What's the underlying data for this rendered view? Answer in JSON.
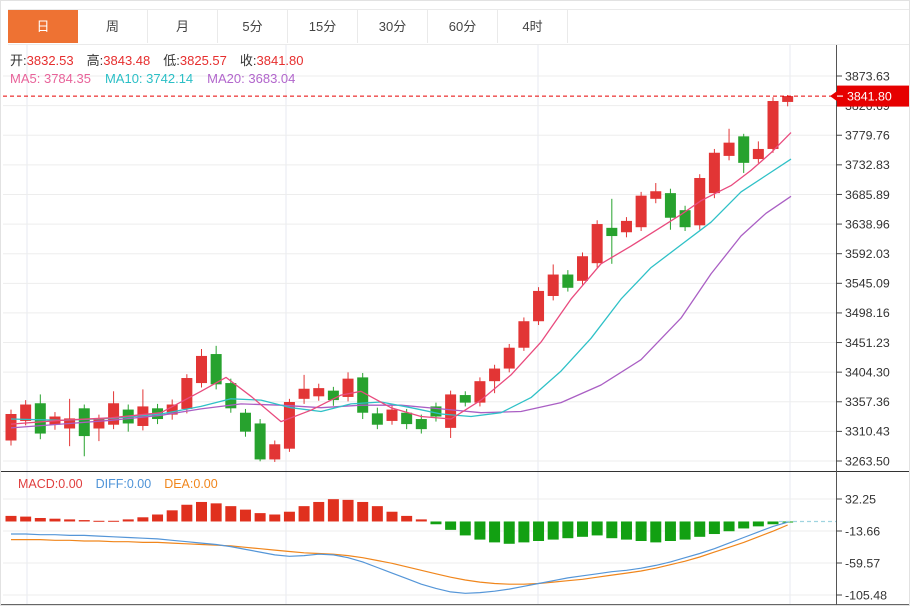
{
  "tabs": [
    {
      "label": "日",
      "active": true
    },
    {
      "label": "周",
      "active": false
    },
    {
      "label": "月",
      "active": false
    },
    {
      "label": "5分",
      "active": false
    },
    {
      "label": "15分",
      "active": false
    },
    {
      "label": "30分",
      "active": false
    },
    {
      "label": "60分",
      "active": false
    },
    {
      "label": "4时",
      "active": false
    }
  ],
  "info": {
    "open_label": "开:",
    "open": "3832.53",
    "high_label": "高:",
    "high": "3843.48",
    "low_label": "低:",
    "low": "3825.57",
    "close_label": "收:",
    "close": "3841.80",
    "ma5_label": "MA5:",
    "ma5": "3784.35",
    "ma10_label": "MA10:",
    "ma10": "3742.14",
    "ma20_label": "MA20:",
    "ma20": "3683.04"
  },
  "macd_labels": {
    "macd": "MACD:0.00",
    "diff": "DIFF:0.00",
    "dea": "DEA:0.00"
  },
  "price_tag": "3841.80",
  "colors": {
    "tab_active_bg": "#ee7233",
    "candle_up": "#e23535",
    "candle_down": "#27a22e",
    "ma5_line": "#e94b7e",
    "ma10_line": "#2fc1c7",
    "ma20_line": "#aa5fc4",
    "macd_bar_up": "#e0301e",
    "macd_bar_down": "#12a012",
    "diff_line": "#5596d8",
    "dea_line": "#f0861c",
    "price_tag_bg": "#e60000",
    "grid": "#ededed",
    "vgrid": "#e7eaf0",
    "axis_dark": "#444"
  },
  "chart_data": {
    "type": "candlestick+macd",
    "main": {
      "y_tick_labels": [
        "3873.63",
        "3826.69",
        "3779.76",
        "3732.83",
        "3685.89",
        "3638.96",
        "3592.03",
        "3545.09",
        "3498.16",
        "3451.23",
        "3404.30",
        "3357.36",
        "3310.43",
        "3263.50"
      ],
      "last_price": 3841.8,
      "candles": [
        [
          3296,
          3345,
          3288,
          3338
        ],
        [
          3327,
          3360,
          3320,
          3353
        ],
        [
          3355,
          3369,
          3298,
          3307
        ],
        [
          3321,
          3341,
          3313,
          3334
        ],
        [
          3315,
          3362,
          3287,
          3331
        ],
        [
          3347,
          3353,
          3271,
          3303
        ],
        [
          3315,
          3337,
          3295,
          3330
        ],
        [
          3321,
          3374,
          3314,
          3355
        ],
        [
          3345,
          3353,
          3310,
          3323
        ],
        [
          3319,
          3377,
          3312,
          3350
        ],
        [
          3347,
          3354,
          3322,
          3330
        ],
        [
          3337,
          3361,
          3329,
          3353
        ],
        [
          3346,
          3401,
          3339,
          3395
        ],
        [
          3387,
          3441,
          3380,
          3430
        ],
        [
          3433,
          3446,
          3377,
          3385
        ],
        [
          3387,
          3394,
          3340,
          3347
        ],
        [
          3340,
          3346,
          3302,
          3310
        ],
        [
          3323,
          3330,
          3263,
          3266
        ],
        [
          3266,
          3296,
          3262,
          3290
        ],
        [
          3283,
          3362,
          3278,
          3357
        ],
        [
          3362,
          3400,
          3354,
          3378
        ],
        [
          3366,
          3386,
          3359,
          3379
        ],
        [
          3375,
          3381,
          3351,
          3360
        ],
        [
          3365,
          3404,
          3358,
          3394
        ],
        [
          3396,
          3403,
          3330,
          3340
        ],
        [
          3339,
          3348,
          3314,
          3321
        ],
        [
          3327,
          3353,
          3321,
          3345
        ],
        [
          3340,
          3346,
          3314,
          3322
        ],
        [
          3330,
          3337,
          3307,
          3314
        ],
        [
          3350,
          3356,
          3326,
          3334
        ],
        [
          3316,
          3375,
          3300,
          3369
        ],
        [
          3368,
          3374,
          3350,
          3356
        ],
        [
          3356,
          3396,
          3350,
          3390
        ],
        [
          3390,
          3416,
          3371,
          3410
        ],
        [
          3410,
          3449,
          3404,
          3443
        ],
        [
          3443,
          3491,
          3438,
          3485
        ],
        [
          3485,
          3539,
          3479,
          3533
        ],
        [
          3525,
          3575,
          3518,
          3559
        ],
        [
          3559,
          3566,
          3532,
          3538
        ],
        [
          3549,
          3594,
          3543,
          3588
        ],
        [
          3577,
          3645,
          3570,
          3639
        ],
        [
          3633,
          3679,
          3576,
          3620
        ],
        [
          3626,
          3650,
          3618,
          3644
        ],
        [
          3634,
          3690,
          3628,
          3684
        ],
        [
          3679,
          3704,
          3672,
          3691
        ],
        [
          3688,
          3695,
          3630,
          3649
        ],
        [
          3661,
          3668,
          3628,
          3634
        ],
        [
          3637,
          3718,
          3630,
          3712
        ],
        [
          3688,
          3758,
          3680,
          3752
        ],
        [
          3747,
          3790,
          3740,
          3768
        ],
        [
          3778,
          3782,
          3720,
          3736
        ],
        [
          3742,
          3770,
          3736,
          3758
        ],
        [
          3758,
          3840,
          3752,
          3834
        ],
        [
          3832.53,
          3843.48,
          3825.57,
          3841.8
        ]
      ],
      "ma5_points": [
        [
          10,
          3322
        ],
        [
          60,
          3328
        ],
        [
          110,
          3332
        ],
        [
          160,
          3340
        ],
        [
          200,
          3374
        ],
        [
          225,
          3396
        ],
        [
          250,
          3366
        ],
        [
          280,
          3326
        ],
        [
          310,
          3344
        ],
        [
          340,
          3368
        ],
        [
          360,
          3374
        ],
        [
          390,
          3348
        ],
        [
          420,
          3334
        ],
        [
          450,
          3330
        ],
        [
          480,
          3360
        ],
        [
          510,
          3400
        ],
        [
          540,
          3452
        ],
        [
          570,
          3520
        ],
        [
          600,
          3576
        ],
        [
          630,
          3604
        ],
        [
          660,
          3634
        ],
        [
          680,
          3654
        ],
        [
          700,
          3676
        ],
        [
          715,
          3688
        ],
        [
          730,
          3700
        ],
        [
          750,
          3724
        ],
        [
          770,
          3752
        ],
        [
          790,
          3784
        ]
      ],
      "ma10_points": [
        [
          10,
          3330
        ],
        [
          60,
          3328
        ],
        [
          110,
          3331
        ],
        [
          160,
          3338
        ],
        [
          200,
          3350
        ],
        [
          230,
          3362
        ],
        [
          260,
          3360
        ],
        [
          290,
          3348
        ],
        [
          320,
          3342
        ],
        [
          350,
          3354
        ],
        [
          380,
          3357
        ],
        [
          410,
          3348
        ],
        [
          440,
          3338
        ],
        [
          470,
          3334
        ],
        [
          500,
          3340
        ],
        [
          530,
          3364
        ],
        [
          560,
          3406
        ],
        [
          590,
          3458
        ],
        [
          620,
          3520
        ],
        [
          650,
          3570
        ],
        [
          680,
          3606
        ],
        [
          710,
          3642
        ],
        [
          740,
          3690
        ],
        [
          765,
          3716
        ],
        [
          790,
          3742
        ]
      ],
      "ma20_points": [
        [
          10,
          3316
        ],
        [
          60,
          3322
        ],
        [
          110,
          3328
        ],
        [
          160,
          3336
        ],
        [
          200,
          3346
        ],
        [
          240,
          3354
        ],
        [
          280,
          3352
        ],
        [
          320,
          3348
        ],
        [
          360,
          3352
        ],
        [
          400,
          3352
        ],
        [
          440,
          3346
        ],
        [
          480,
          3340
        ],
        [
          520,
          3342
        ],
        [
          560,
          3356
        ],
        [
          600,
          3384
        ],
        [
          640,
          3424
        ],
        [
          680,
          3490
        ],
        [
          710,
          3560
        ],
        [
          740,
          3620
        ],
        [
          765,
          3656
        ],
        [
          790,
          3683
        ]
      ]
    },
    "macd": {
      "y_tick_labels": [
        "32.25",
        "-13.66",
        "-59.57",
        "-105.48"
      ],
      "histogram": [
        8,
        7,
        5,
        4,
        3,
        2,
        1,
        1,
        3,
        6,
        10,
        16,
        24,
        28,
        26,
        22,
        17,
        12,
        10,
        14,
        22,
        28,
        32,
        31,
        28,
        22,
        14,
        8,
        3,
        -4,
        -12,
        -20,
        -26,
        -30,
        -32,
        -30,
        -28,
        -26,
        -24,
        -22,
        -20,
        -24,
        -26,
        -28,
        -30,
        -28,
        -26,
        -22,
        -18,
        -14,
        -10,
        -7,
        -4,
        -1.5
      ],
      "diff": [
        -18,
        -18,
        -19,
        -19,
        -20,
        -20,
        -21,
        -22,
        -23,
        -24,
        -25,
        -27,
        -29,
        -31,
        -33,
        -36,
        -40,
        -44,
        -48,
        -50,
        -49,
        -47,
        -48,
        -52,
        -58,
        -66,
        -74,
        -82,
        -90,
        -96,
        -101,
        -103,
        -102,
        -100,
        -97,
        -93,
        -89,
        -85,
        -81,
        -78,
        -75,
        -72,
        -70,
        -67,
        -63,
        -58,
        -52,
        -46,
        -39,
        -31,
        -23,
        -15,
        -7,
        -1
      ],
      "dea": [
        -26,
        -26,
        -26,
        -27,
        -27,
        -28,
        -28,
        -29,
        -29,
        -30,
        -30,
        -31,
        -32,
        -33,
        -34,
        -35,
        -37,
        -39,
        -41,
        -43,
        -45,
        -46,
        -47,
        -49,
        -52,
        -56,
        -60,
        -65,
        -70,
        -75,
        -80,
        -84,
        -87,
        -89,
        -90,
        -90,
        -89,
        -87,
        -85,
        -83,
        -80,
        -77,
        -74,
        -71,
        -67,
        -62,
        -57,
        -51,
        -44,
        -37,
        -30,
        -22,
        -14,
        -5
      ]
    }
  }
}
